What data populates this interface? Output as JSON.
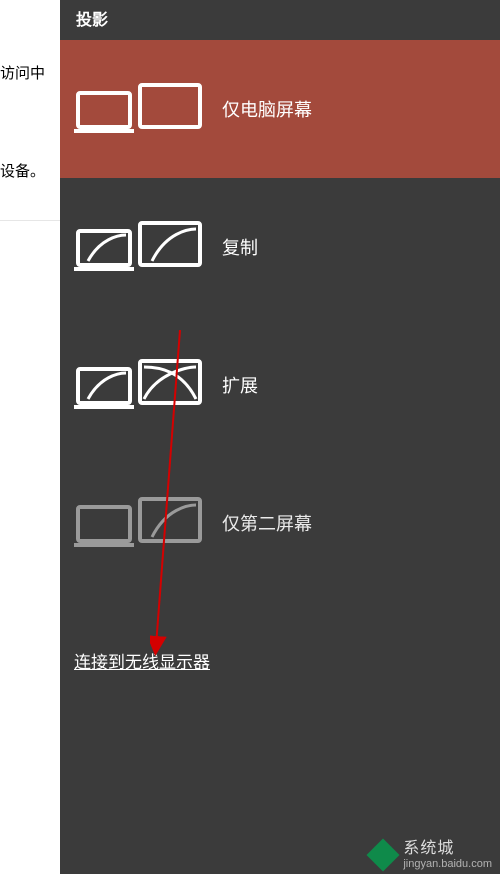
{
  "background": {
    "text1": "访问中",
    "text2": "设备。"
  },
  "panel": {
    "title": "投影",
    "options": [
      {
        "label": "仅电脑屏幕",
        "selected": true,
        "name": "option-pc-only"
      },
      {
        "label": "复制",
        "selected": false,
        "name": "option-duplicate"
      },
      {
        "label": "扩展",
        "selected": false,
        "name": "option-extend"
      },
      {
        "label": "仅第二屏幕",
        "selected": false,
        "name": "option-second-only"
      }
    ],
    "connect_link": "连接到无线显示器"
  },
  "watermark": {
    "main_text": "系统城",
    "sub_text": "jingyan.baidu.com"
  }
}
